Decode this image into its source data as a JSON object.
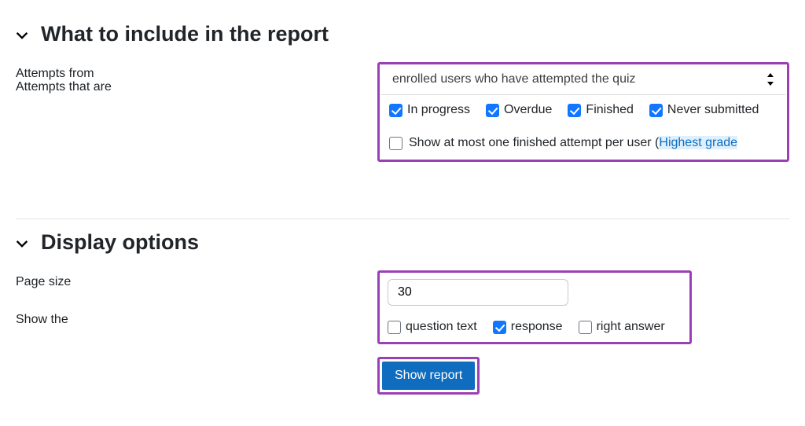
{
  "section_include": {
    "title": "What to include in the report",
    "attempts_from": {
      "label": "Attempts from",
      "value": "enrolled users who have attempted the quiz"
    },
    "attempts_that_are": {
      "label": "Attempts that are",
      "options": {
        "in_progress": {
          "label": "In progress",
          "checked": true
        },
        "overdue": {
          "label": "Overdue",
          "checked": true
        },
        "finished": {
          "label": "Finished",
          "checked": true
        },
        "never_submitted": {
          "label": "Never submitted",
          "checked": true
        }
      },
      "one_attempt": {
        "label_prefix": "Show at most one finished attempt per user (",
        "link_text": "Highest grade",
        "checked": false
      }
    }
  },
  "section_display": {
    "title": "Display options",
    "page_size": {
      "label": "Page size",
      "value": "30"
    },
    "show_the": {
      "label": "Show the",
      "options": {
        "question_text": {
          "label": "question text",
          "checked": false
        },
        "response": {
          "label": "response",
          "checked": true
        },
        "right_answer": {
          "label": "right answer",
          "checked": false
        }
      }
    },
    "submit_label": "Show report"
  },
  "colors": {
    "accent": "#1177ff",
    "highlight_border": "#9a3fb5",
    "primary_btn": "#0f6cbf",
    "link_bg": "#def0fd"
  }
}
